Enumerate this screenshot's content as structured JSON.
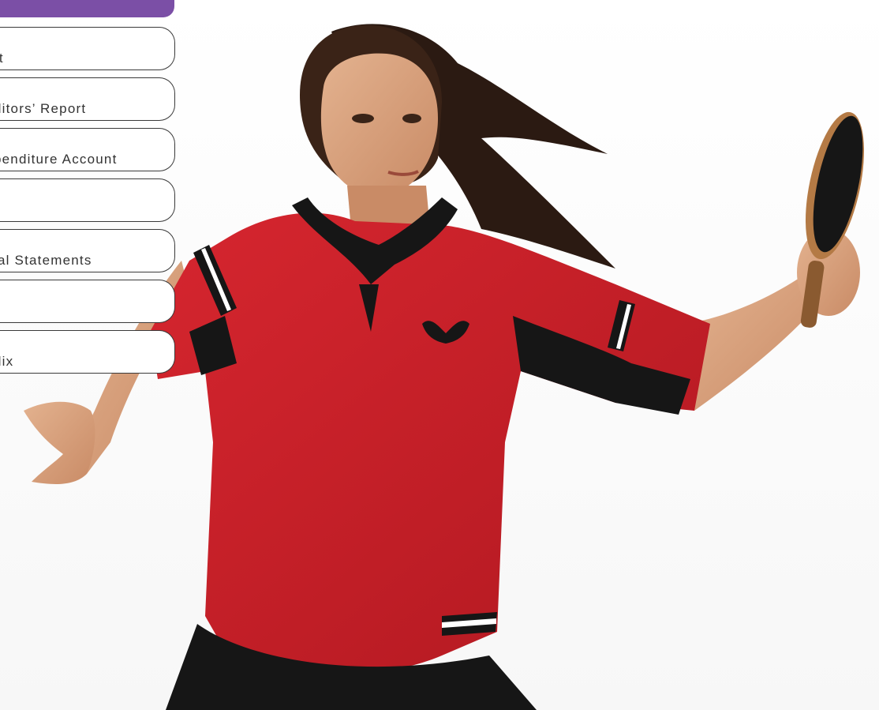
{
  "header": {
    "accent_color": "#7b4fa6"
  },
  "nav": {
    "items": [
      {
        "label": "rt"
      },
      {
        "label": "ditors’ Report"
      },
      {
        "label": "penditure Account"
      },
      {
        "label": ""
      },
      {
        "label": "ial Statements"
      },
      {
        "label": ""
      },
      {
        "label": "dix"
      }
    ]
  },
  "photo": {
    "description_icon": "table-tennis-player-photo",
    "colors": {
      "shirt": "#c8202a",
      "shirt_dark": "#8e1219",
      "black": "#161616",
      "skin": "#d7a27f",
      "paddle": "#b47a45"
    }
  }
}
